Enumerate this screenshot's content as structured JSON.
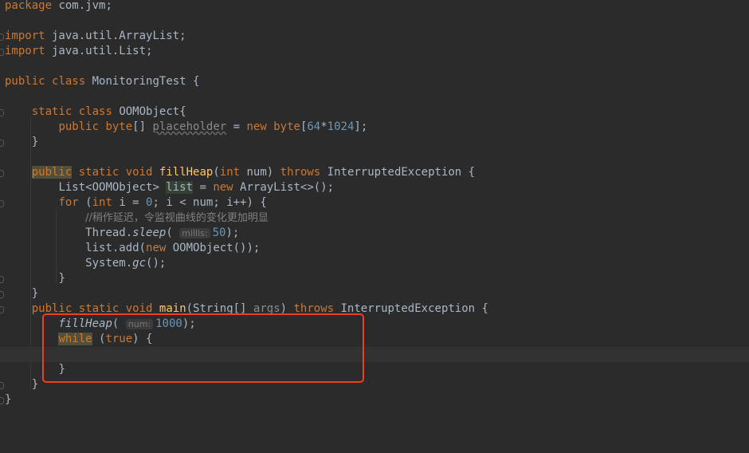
{
  "code": {
    "l1": {
      "kw": "package",
      "rest": " com.jvm;"
    },
    "l3": {
      "kw": "import",
      "rest": " java.util.ArrayList;"
    },
    "l4": {
      "kw": "import",
      "rest": " java.util.List;"
    },
    "l6": {
      "kw1": "public",
      "kw2": "class",
      "name": "MonitoringTest",
      "rest": " {"
    },
    "l8": {
      "kw1": "static",
      "kw2": "class",
      "name": "OOMObject",
      "rest": "{"
    },
    "l9": {
      "kw1": "public",
      "type": "byte",
      "arr": "[]",
      "var": "placeholder",
      "eq": " = ",
      "kw2": "new",
      "type2": "byte",
      "open": "[",
      "n1": "64",
      "op": "*",
      "n2": "1024",
      "close": "];"
    },
    "l10": {
      "text": "}"
    },
    "l12": {
      "kw1": "public",
      "kw2": "static",
      "kw3": "void",
      "fn": "fillHeap",
      "p1": "(",
      "ptype": "int",
      "pname": " num) ",
      "kw4": "throws",
      "rest": " InterruptedException {"
    },
    "l13": {
      "t1": "List<OOMObject> ",
      "var": "list",
      "eq": " = ",
      "kw": "new",
      "rest": " ArrayList<>();"
    },
    "l14": {
      "kw1": "for",
      "p1": " (",
      "kw2": "int",
      "v1": " i = ",
      "n1": "0",
      "s1": "; i < num; i++) {"
    },
    "l15": {
      "comment": "//稍作延迟，令监视曲线的变化更加明显"
    },
    "l16": {
      "cls": "Thread.",
      "fn": "sleep",
      "p1": "(",
      "hint": "millis:",
      "num": "50",
      "rest": ");"
    },
    "l17": {
      "t1": "list.add(",
      "kw": "new",
      "rest": " OOMObject());"
    },
    "l18": {
      "cls": "System.",
      "fn": "gc",
      "rest": "();"
    },
    "l19": {
      "text": "}"
    },
    "l20": {
      "text": "}"
    },
    "l21": {
      "kw1": "public",
      "kw2": "static",
      "kw3": "void",
      "fn": "main",
      "p1": "(String[] ",
      "pname": "args",
      "p2": ") ",
      "kw4": "throws",
      "rest": " InterruptedException {"
    },
    "l22": {
      "fn": "fillHeap",
      "p1": "(",
      "hint": "num:",
      "num": "1000",
      "rest": ");"
    },
    "l23": {
      "kw1": "while",
      "p1": " (",
      "kw2": "true",
      "rest": ") {"
    },
    "l25": {
      "text": "}"
    },
    "l26": {
      "text": "}"
    },
    "l27": {
      "text": "}"
    }
  },
  "colors": {
    "background": "#2b2b2b",
    "keyword": "#cc7832",
    "function": "#ffc66d",
    "number": "#6897bb",
    "comment": "#808080",
    "text": "#a9b7c6",
    "highlight_box": "#e8431f"
  }
}
